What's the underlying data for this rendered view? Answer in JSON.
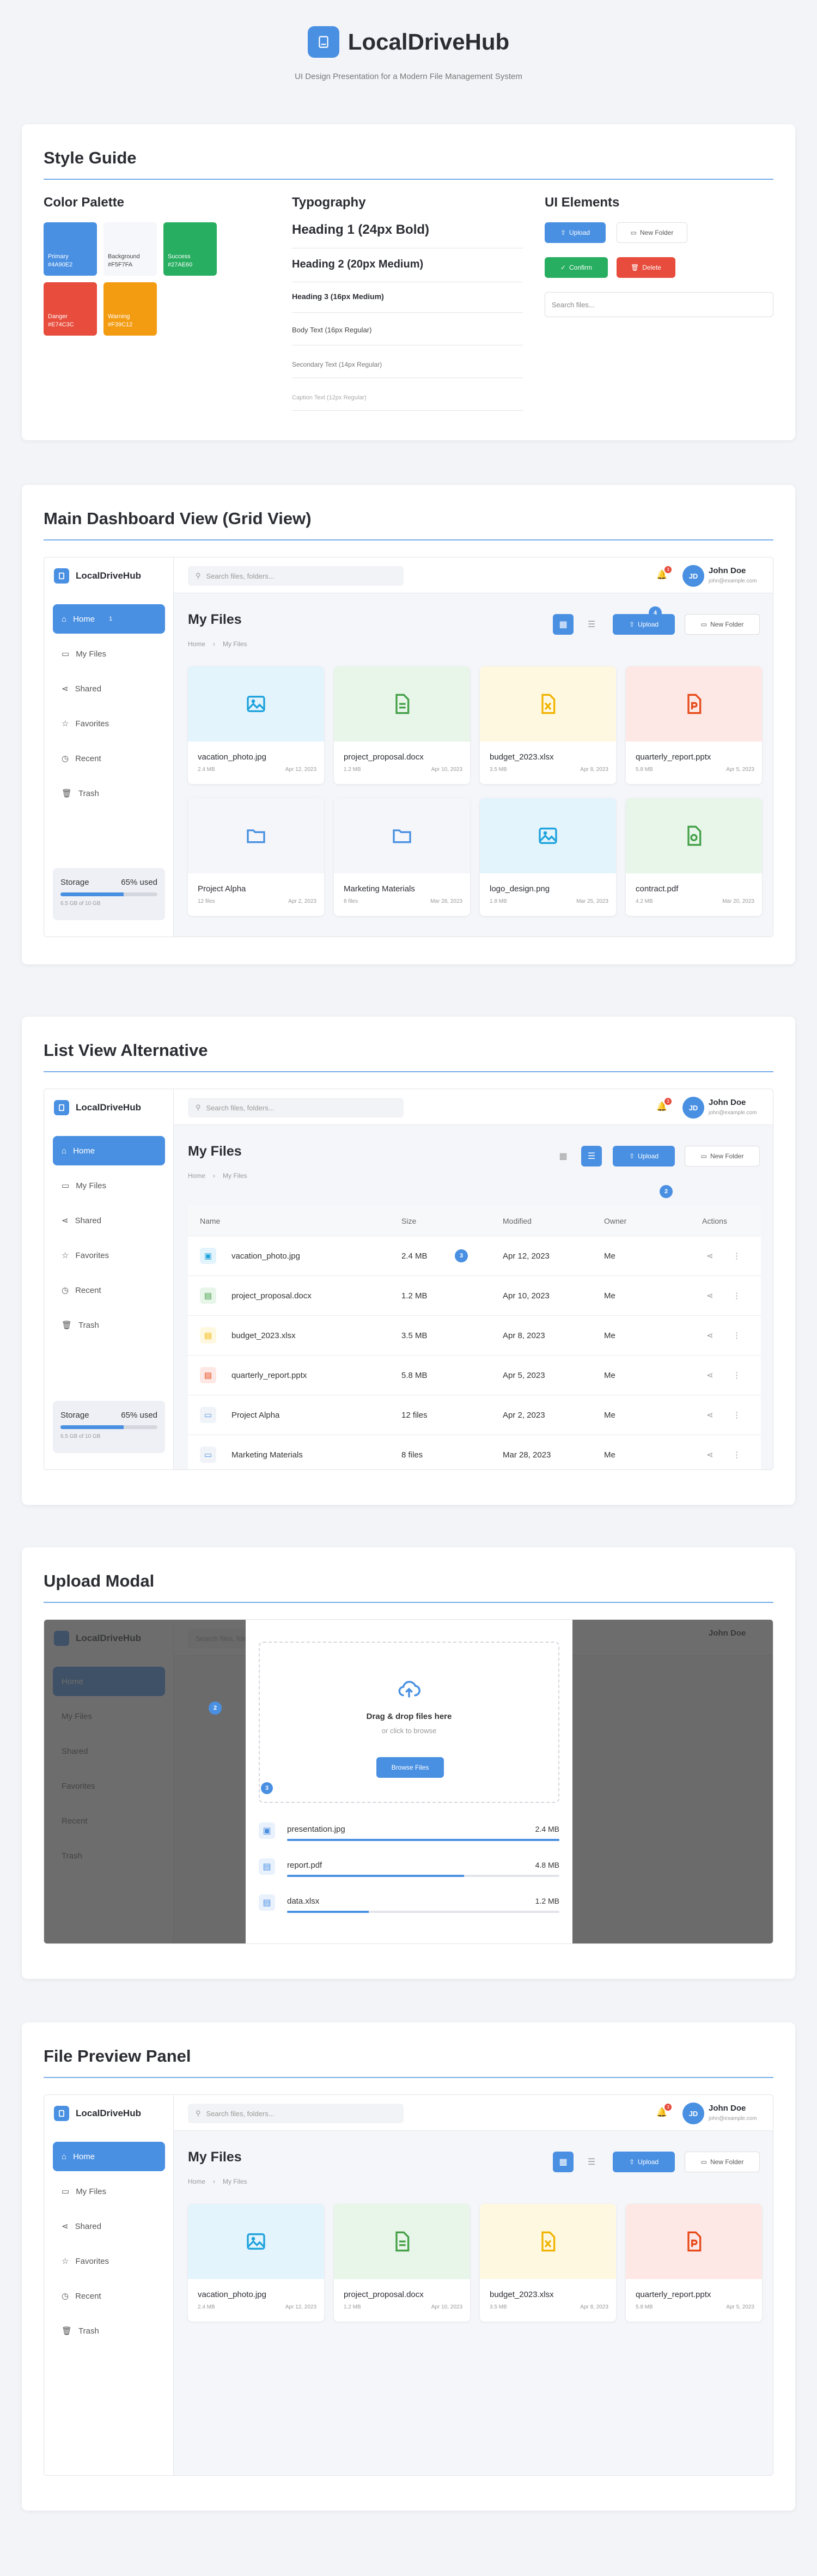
{
  "header": {
    "title": "LocalDriveHub",
    "subtitle": "UI Design Presentation for a Modern File Management System"
  },
  "style_guide": {
    "title": "Style Guide",
    "palette_title": "Color Palette",
    "colors": [
      {
        "name": "Primary",
        "hex": "#4A90E2"
      },
      {
        "name": "Background",
        "hex": "#F5F7FA"
      },
      {
        "name": "Success",
        "hex": "#27AE60"
      },
      {
        "name": "Danger",
        "hex": "#E74C3C"
      },
      {
        "name": "Warning",
        "hex": "#F39C12"
      }
    ],
    "typo_title": "Typography",
    "typo": [
      "Heading 1 (24px Bold)",
      "Heading 2 (20px Medium)",
      "Heading 3 (16px Medium)",
      "Body Text (16px Regular)",
      "Secondary Text (14px Regular)",
      "Caption Text (12px Regular)"
    ],
    "ui_title": "UI Elements",
    "buttons": {
      "upload": "Upload",
      "new_folder": "New Folder",
      "confirm": "Confirm",
      "delete": "Delete"
    },
    "search_placeholder": "Search files..."
  },
  "app": {
    "brand": "LocalDriveHub",
    "nav": [
      "Home",
      "My Files",
      "Shared",
      "Favorites",
      "Recent",
      "Trash"
    ],
    "storage_label": "Storage",
    "storage_pct_text": "65% used",
    "storage_fraction": 0.65,
    "storage_detail": "6.5 GB of 10 GB",
    "search_placeholder": "Search files, folders...",
    "notif_count": "3",
    "user_initials": "JD",
    "user_name": "John Doe",
    "user_email": "john@example.com",
    "page_title": "My Files",
    "crumbs": [
      "Home",
      "›",
      "My Files"
    ],
    "upload_label": "Upload",
    "new_folder_label": "New Folder"
  },
  "sections": {
    "grid": "Main Dashboard View (Grid View)",
    "list": "List View Alternative",
    "upload": "Upload Modal",
    "preview": "File Preview Panel"
  },
  "badges": {
    "b1": "1",
    "b2": "2",
    "b3": "3",
    "b4": "4"
  },
  "files": [
    {
      "name": "vacation_photo.jpg",
      "meta": "2.4 MB",
      "date": "Apr 12, 2023",
      "kind": "image",
      "owner": "Me"
    },
    {
      "name": "project_proposal.docx",
      "meta": "1.2 MB",
      "date": "Apr 10, 2023",
      "kind": "doc",
      "owner": "Me"
    },
    {
      "name": "budget_2023.xlsx",
      "meta": "3.5 MB",
      "date": "Apr 8, 2023",
      "kind": "sheet",
      "owner": "Me"
    },
    {
      "name": "quarterly_report.pptx",
      "meta": "5.8 MB",
      "date": "Apr 5, 2023",
      "kind": "slides",
      "owner": "Me"
    },
    {
      "name": "Project Alpha",
      "meta": "12 files",
      "date": "Apr 2, 2023",
      "kind": "folder",
      "owner": "Me"
    },
    {
      "name": "Marketing Materials",
      "meta": "8 files",
      "date": "Mar 28, 2023",
      "kind": "folder",
      "owner": "Me"
    },
    {
      "name": "logo_design.png",
      "meta": "1.8 MB",
      "date": "Mar 25, 2023",
      "kind": "image",
      "owner": "Me"
    },
    {
      "name": "contract.pdf",
      "meta": "4.2 MB",
      "date": "Mar 20, 2023",
      "kind": "doc",
      "owner": "Me"
    }
  ],
  "list": {
    "headers": [
      "Name",
      "Size",
      "Modified",
      "Owner",
      "Actions"
    ],
    "list_dates": [
      "Apr 12, 2023",
      "Apr 10, 2023",
      "Apr 8, 2023",
      "Apr 5, 2023",
      "Apr 2, 2023",
      "Mar 28, 2023"
    ]
  },
  "upload": {
    "drop_title": "Drag & drop files here",
    "drop_sub": "or click to browse",
    "browse": "Browse Files",
    "items": [
      {
        "name": "presentation.jpg",
        "size": "2.4 MB",
        "progress": 1.0
      },
      {
        "name": "report.pdf",
        "size": "4.8 MB",
        "progress": 0.65
      },
      {
        "name": "data.xlsx",
        "size": "1.2 MB",
        "progress": 0.3
      }
    ]
  },
  "colors": {
    "primary": "#4a90e2",
    "success": "#27ae60",
    "danger": "#e74c3c",
    "warning": "#f39c12"
  }
}
